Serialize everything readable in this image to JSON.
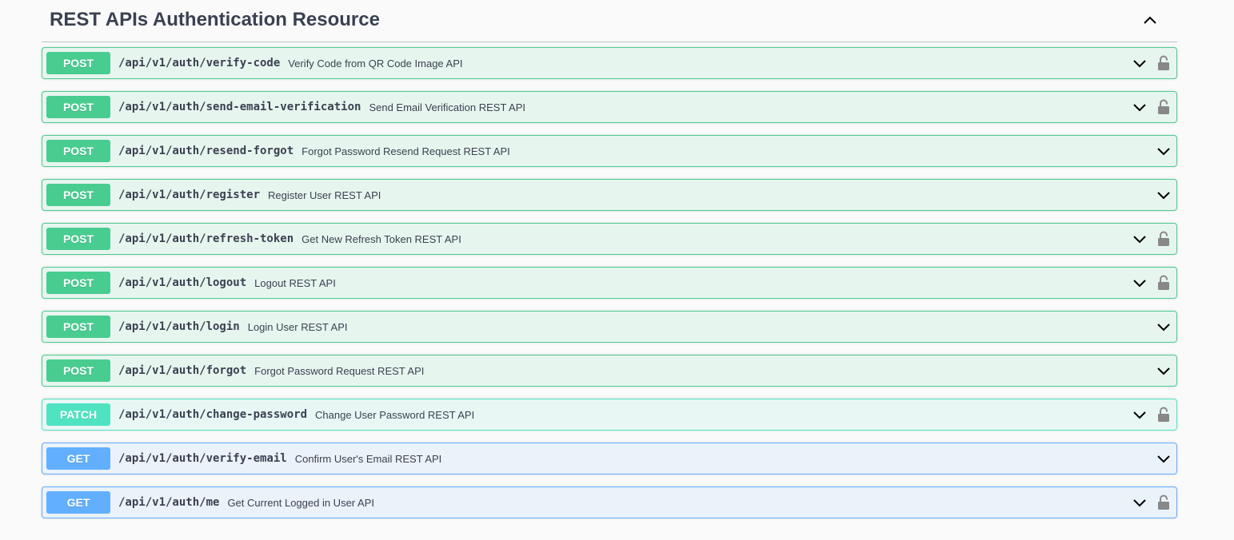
{
  "section": {
    "title": "REST APIs Authentication Resource",
    "collapse_icon": "chevron-up-icon"
  },
  "colors": {
    "post": "#49cc90",
    "patch": "#50e3c2",
    "get": "#61affe",
    "text": "#3b4151",
    "lock": "#888888"
  },
  "operations": [
    {
      "method": "POST",
      "path": "/api/v1/auth/verify-code",
      "summary": "Verify Code from QR Code Image API",
      "locked": true
    },
    {
      "method": "POST",
      "path": "/api/v1/auth/send-email-verification",
      "summary": "Send Email Verification REST API",
      "locked": true
    },
    {
      "method": "POST",
      "path": "/api/v1/auth/resend-forgot",
      "summary": "Forgot Password Resend Request REST API",
      "locked": false
    },
    {
      "method": "POST",
      "path": "/api/v1/auth/register",
      "summary": "Register User REST API",
      "locked": false
    },
    {
      "method": "POST",
      "path": "/api/v1/auth/refresh-token",
      "summary": "Get New Refresh Token REST API",
      "locked": true
    },
    {
      "method": "POST",
      "path": "/api/v1/auth/logout",
      "summary": "Logout REST API",
      "locked": true
    },
    {
      "method": "POST",
      "path": "/api/v1/auth/login",
      "summary": "Login User REST API",
      "locked": false
    },
    {
      "method": "POST",
      "path": "/api/v1/auth/forgot",
      "summary": "Forgot Password Request REST API",
      "locked": false
    },
    {
      "method": "PATCH",
      "path": "/api/v1/auth/change-password",
      "summary": "Change User Password REST API",
      "locked": true
    },
    {
      "method": "GET",
      "path": "/api/v1/auth/verify-email",
      "summary": "Confirm User's Email REST API",
      "locked": false
    },
    {
      "method": "GET",
      "path": "/api/v1/auth/me",
      "summary": "Get Current Logged in User API",
      "locked": true
    }
  ]
}
